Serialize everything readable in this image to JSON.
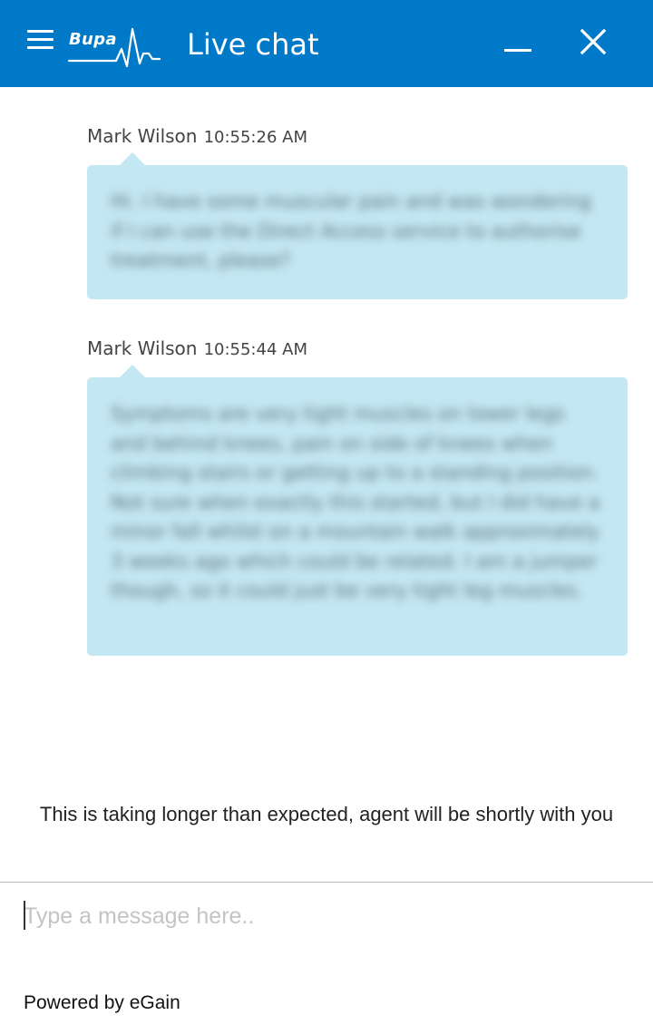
{
  "header": {
    "logo_text": "Bupa",
    "title": "Live chat",
    "background_color": "#0079c8",
    "icons": {
      "menu": "hamburger-menu-icon",
      "minimize": "minimize-icon",
      "close": "close-icon"
    }
  },
  "messages": [
    {
      "author": "Mark Wilson",
      "time": "10:55:26 AM",
      "text": "Hi. I have some muscular pain and was wondering if I can use the Direct Access service to authorise treatment, please?"
    },
    {
      "author": "Mark Wilson",
      "time": "10:55:44 AM",
      "text": "Symptoms are very tight muscles on lower legs and behind knees, pain on side of knees when climbing stairs or getting up to a standing position. Not sure when exactly this started, but I did have a minor fall whilst on a mountain walk approximately 3 weeks ago which could be related. I am a jumper though, so it could just be very tight leg muscles."
    }
  ],
  "bubble_color": "#c4e8f3",
  "status": {
    "text": "This is taking longer than expected, agent will be shortly with you"
  },
  "input": {
    "value": "",
    "placeholder": "Type a message here.."
  },
  "footer": {
    "powered_by": "Powered by eGain"
  }
}
